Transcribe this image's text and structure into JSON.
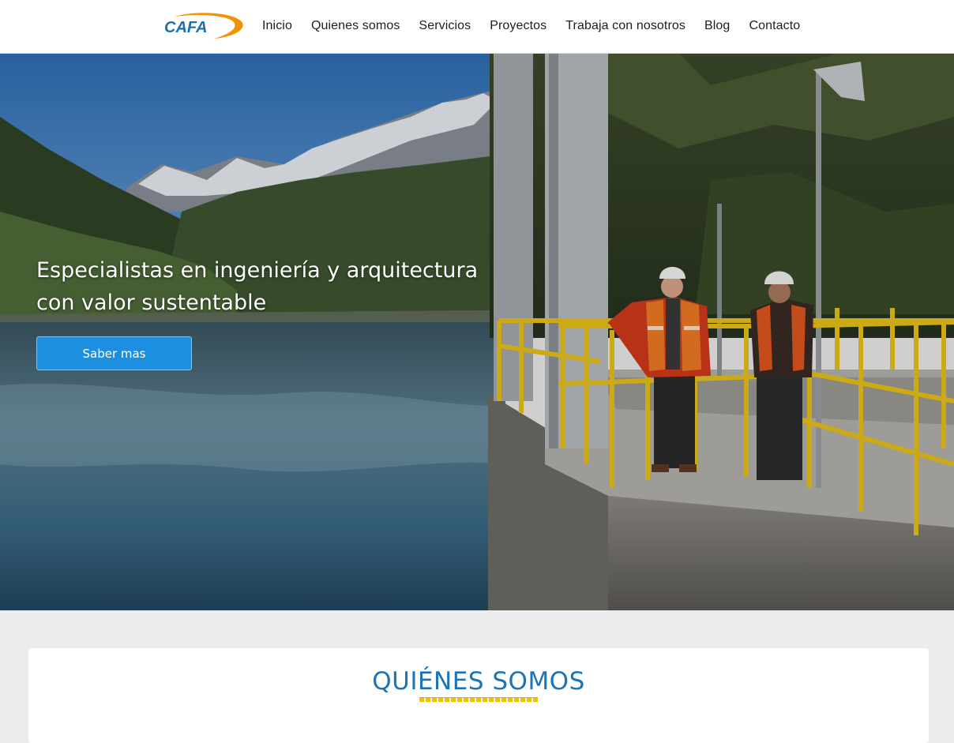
{
  "brand": {
    "logo_text": "CAFA",
    "colors": {
      "blue": "#1b6fb5",
      "orange": "#f39200",
      "accent": "#1d8fe0"
    }
  },
  "nav": {
    "items": [
      {
        "label": "Inicio"
      },
      {
        "label": "Quienes somos"
      },
      {
        "label": "Servicios"
      },
      {
        "label": "Proyectos"
      },
      {
        "label": "Trabaja con nosotros"
      },
      {
        "label": "Blog"
      },
      {
        "label": "Contacto"
      }
    ]
  },
  "hero": {
    "heading": "Especialistas en ingeniería y arquitectura con valor sustentable",
    "button_label": "Saber mas"
  },
  "about": {
    "title": "QUIÉNES SOMOS"
  }
}
